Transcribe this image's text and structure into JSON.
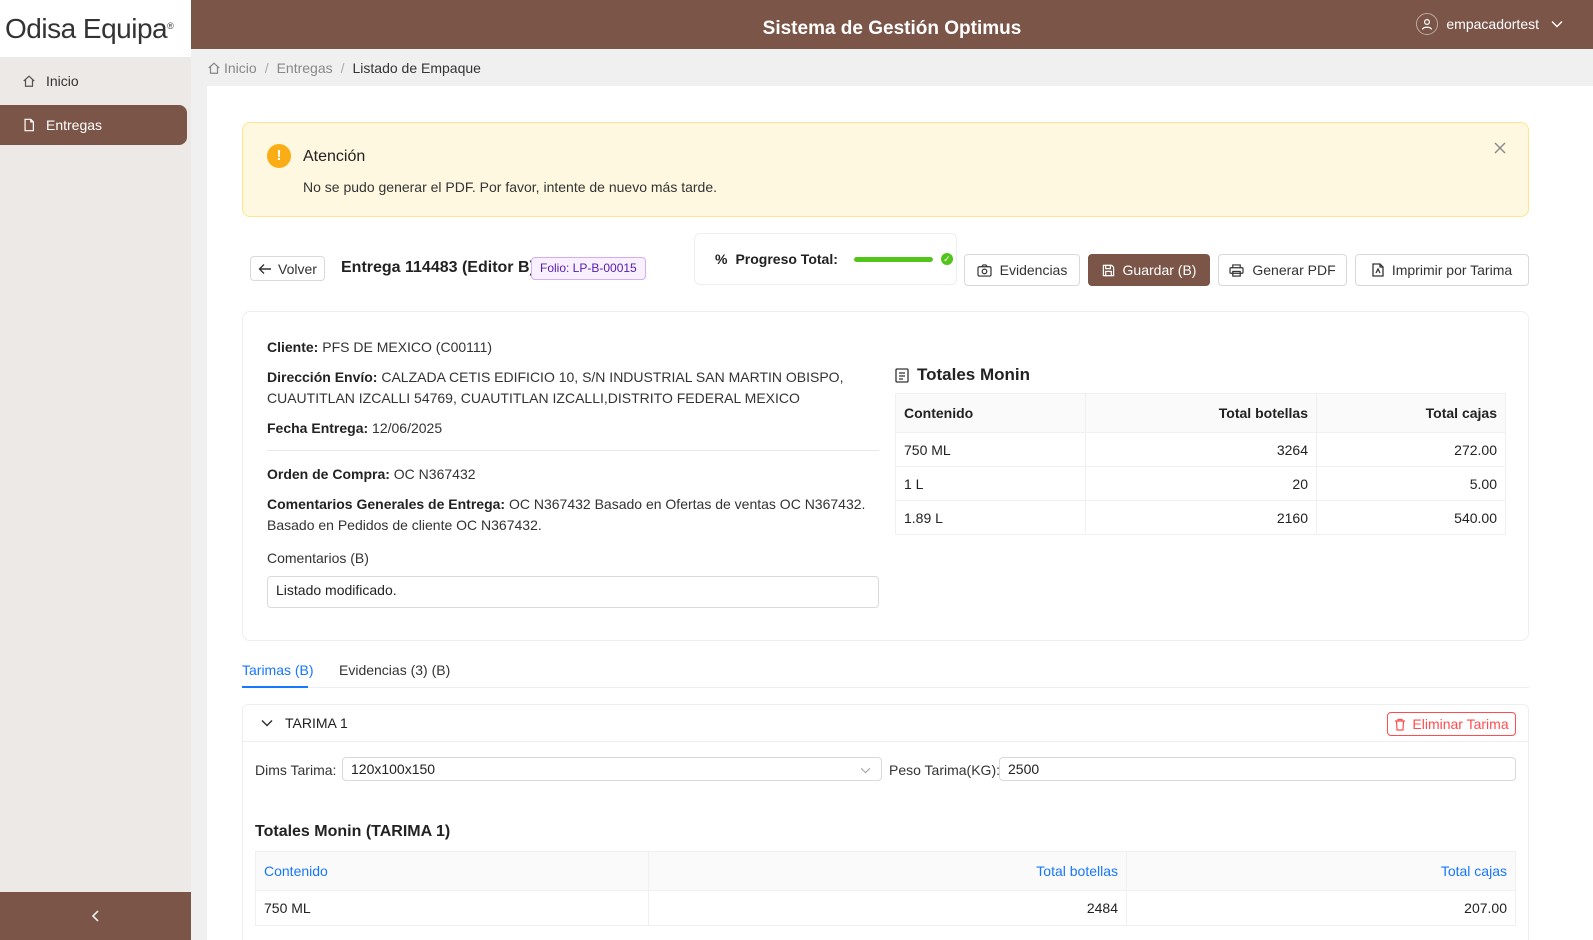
{
  "sidebar": {
    "logo": "Odisa Equipa",
    "logo_mark": "®",
    "items": [
      {
        "label": "Inicio"
      },
      {
        "label": "Entregas"
      }
    ]
  },
  "header": {
    "title": "Sistema de Gestión Optimus",
    "user": "empacadortest"
  },
  "breadcrumb": {
    "home": "Inicio",
    "section": "Entregas",
    "current": "Listado de Empaque",
    "separator": "/"
  },
  "alert": {
    "title": "Atención",
    "message": "No se pudo generar el PDF. Por favor, intente de nuevo más tarde.",
    "icon": "!"
  },
  "toolbar": {
    "back": "Volver",
    "delivery_title": "Entrega 114483 (Editor B)",
    "folio": "Folio: LP-B-00015",
    "progress_label": "Progreso Total:",
    "progress_value": 1.0,
    "evidencias": "Evidencias",
    "guardar": "Guardar (B)",
    "generar_pdf": "Generar PDF",
    "imprimir": "Imprimir por Tarima"
  },
  "details": {
    "cliente_label": "Cliente:",
    "cliente": "PFS DE MEXICO (C00111)",
    "direccion_label": "Dirección Envío:",
    "direccion": "CALZADA CETIS EDIFICIO 10, S/N INDUSTRIAL SAN MARTIN OBISPO, CUAUTITLAN IZCALLI 54769, CUAUTITLAN IZCALLI,DISTRITO FEDERAL MEXICO",
    "fecha_label": "Fecha Entrega:",
    "fecha": "12/06/2025",
    "orden_label": "Orden de Compra:",
    "orden": "OC N367432",
    "comentarios_gen_label": "Comentarios Generales de Entrega:",
    "comentarios_gen": "OC N367432 Basado en Ofertas de ventas OC N367432. Basado en Pedidos de cliente OC N367432.",
    "comentarios_label": "Comentarios (B)",
    "comentarios_value": "Listado modificado."
  },
  "totales": {
    "title": "Totales Monin",
    "headers": [
      "Contenido",
      "Total botellas",
      "Total cajas"
    ],
    "rows": [
      [
        "750 ML",
        "3264",
        "272.00"
      ],
      [
        "1 L",
        "20",
        "5.00"
      ],
      [
        "1.89 L",
        "2160",
        "540.00"
      ]
    ]
  },
  "tabs": [
    {
      "label": "Tarimas (B)"
    },
    {
      "label": "Evidencias (3) (B)"
    }
  ],
  "pallet": {
    "name": "TARIMA 1",
    "delete": "Eliminar Tarima",
    "dims_label": "Dims Tarima:",
    "dims_value": "120x100x150",
    "peso_label": "Peso Tarima(KG):",
    "peso_value": "2500",
    "totals_title": "Totales Monin (TARIMA 1)",
    "headers": [
      "Contenido",
      "Total botellas",
      "Total cajas"
    ],
    "rows": [
      [
        "750 ML",
        "2484",
        "207.00"
      ]
    ]
  },
  "colors": {
    "brand": "#7a5548",
    "link": "#1677ff",
    "success": "#52c41a",
    "warning": "#faad14",
    "danger": "#ff4d4f"
  }
}
